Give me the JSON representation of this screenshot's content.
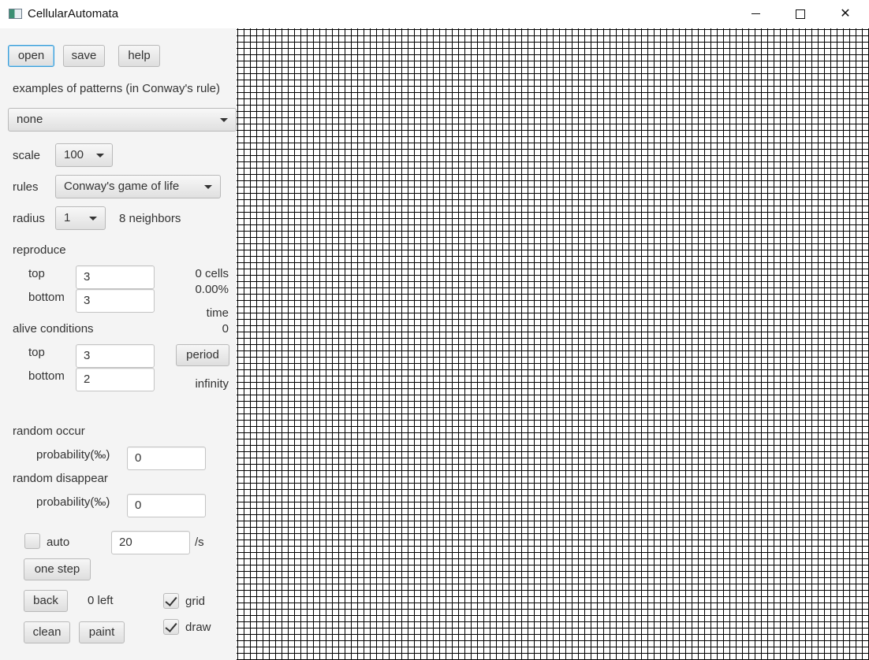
{
  "window": {
    "title": "CellularAutomata"
  },
  "toolbar": {
    "open_label": "open",
    "save_label": "save",
    "help_label": "help"
  },
  "patterns": {
    "label": "examples of patterns (in Conway's rule)",
    "selected": "none"
  },
  "scale": {
    "label": "scale",
    "selected": "100"
  },
  "rules": {
    "label": "rules",
    "selected": "Conway's game of life"
  },
  "radius": {
    "label": "radius",
    "selected": "1",
    "neighbors_text": "8 neighbors"
  },
  "reproduce": {
    "label": "reproduce",
    "top_label": "top",
    "top_value": "3",
    "bottom_label": "bottom",
    "bottom_value": "3"
  },
  "stats": {
    "cells": "0 cells",
    "percent": "0.00%",
    "time_label": "time",
    "time_value": "0",
    "period_label": "period",
    "period_value": "infinity"
  },
  "alive": {
    "label": "alive conditions",
    "top_label": "top",
    "top_value": "3",
    "bottom_label": "bottom",
    "bottom_value": "2"
  },
  "random_occur": {
    "label": "random occur",
    "prob_label": "probability(‰)",
    "value": "0"
  },
  "random_disappear": {
    "label": "random disappear",
    "prob_label": "probability(‰)",
    "value": "0"
  },
  "auto": {
    "label": "auto",
    "checked": false,
    "rate_value": "20",
    "rate_unit": "/s"
  },
  "controls": {
    "one_step_label": "one step",
    "back_label": "back",
    "left_text": "0 left",
    "clean_label": "clean",
    "paint_label": "paint"
  },
  "options": {
    "grid_label": "grid",
    "grid_checked": true,
    "draw_label": "draw",
    "draw_checked": true
  }
}
